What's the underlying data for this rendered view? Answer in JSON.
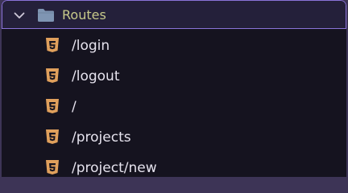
{
  "explorer": {
    "folder": {
      "label": "Routes",
      "expanded": true,
      "icon": "folder-icon",
      "chevron_icon": "chevron-down-icon"
    },
    "files": [
      {
        "label": "/login",
        "icon": "html5-icon"
      },
      {
        "label": "/logout",
        "icon": "html5-icon"
      },
      {
        "label": "/",
        "icon": "html5-icon"
      },
      {
        "label": "/projects",
        "icon": "html5-icon"
      },
      {
        "label": "/project/new",
        "icon": "html5-icon"
      }
    ]
  },
  "colors": {
    "panel_background": "#15131f",
    "selected_row_background": "#24203a",
    "selected_row_border": "#8a73d8",
    "folder_label": "#c7c98a",
    "folder_icon": "#7f95b3",
    "file_label": "#e6e3ee",
    "html5_icon": "#e0a05c"
  }
}
